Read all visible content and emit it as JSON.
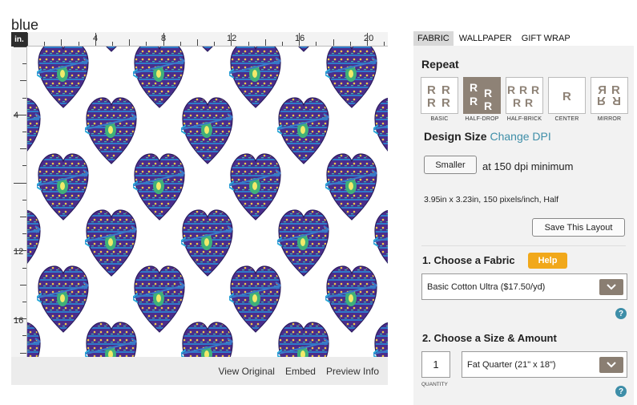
{
  "design": {
    "title": "blue"
  },
  "preview": {
    "unit": "in.",
    "ruler_top_labels": [
      "4",
      "8",
      "12",
      "16",
      "20"
    ],
    "ruler_left_labels": [
      "4",
      "12",
      "16"
    ],
    "links": [
      "View Original",
      "Embed",
      "Preview Info"
    ]
  },
  "tabs": [
    {
      "label": "FABRIC",
      "active": true
    },
    {
      "label": "WALLPAPER",
      "active": false
    },
    {
      "label": "GIFT WRAP",
      "active": false
    }
  ],
  "repeat": {
    "heading": "Repeat",
    "selected": "HALF-DROP",
    "options": [
      {
        "label": "BASIC"
      },
      {
        "label": "HALF-DROP"
      },
      {
        "label": "HALF-BRICK"
      },
      {
        "label": "CENTER"
      },
      {
        "label": "MIRROR"
      }
    ]
  },
  "design_size": {
    "heading": "Design Size",
    "link": "Change DPI",
    "smaller_button": "Smaller",
    "dpi_text": "at 150 dpi minimum",
    "dimensions": "3.95in x 3.23in, 150 pixels/inch, Half",
    "save_button": "Save This Layout"
  },
  "fabric": {
    "heading": "1. Choose a Fabric",
    "help": "Help",
    "selected": "Basic Cotton Ultra ($17.50/yd)"
  },
  "size": {
    "heading": "2. Choose a Size & Amount",
    "quantity": "1",
    "quantity_label": "QUANTITY",
    "selected": "Fat Quarter (21\" x 18\")"
  },
  "colors": {
    "accent": "#3e8ea8",
    "help_badge": "#f1a81a",
    "selected_repeat": "#8e8276",
    "select_arrow": "#8a7e72",
    "panel_bg": "#f2f2f2",
    "heart_fill": "#4a2d8c"
  },
  "icons": {
    "dropdown": "chevron-down-icon",
    "question": "question-mark-icon"
  }
}
